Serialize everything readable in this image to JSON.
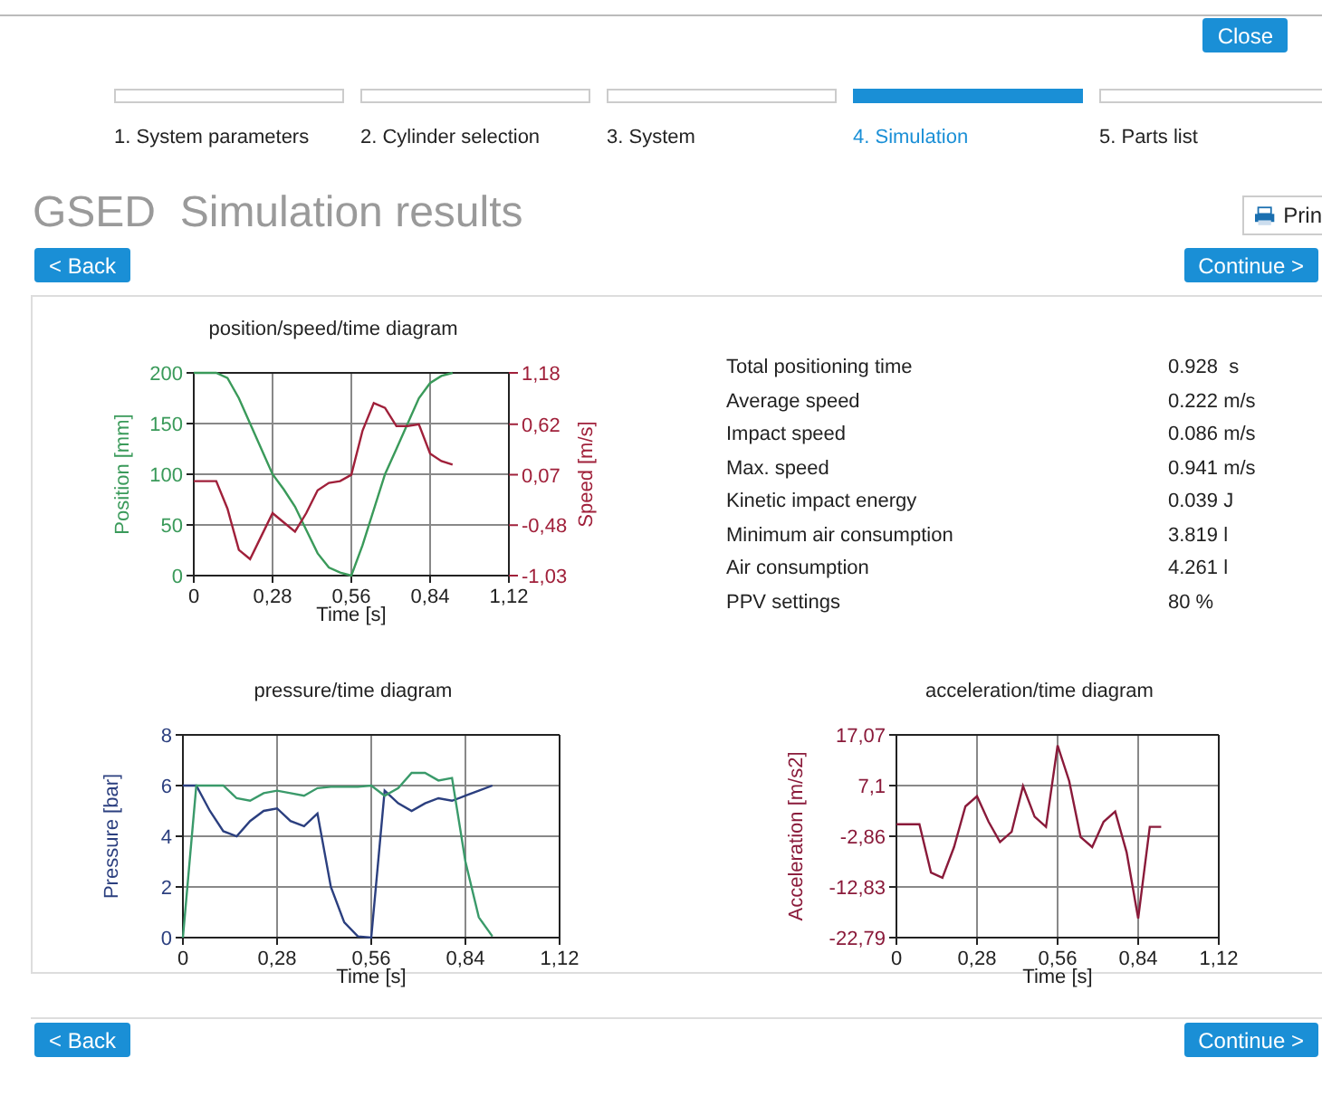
{
  "header": {
    "close_button": "Close"
  },
  "steps": [
    {
      "label": "1. System parameters",
      "selected": false
    },
    {
      "label": "2. Cylinder selection",
      "selected": false
    },
    {
      "label": "3. System",
      "selected": false
    },
    {
      "label": "4. Simulation",
      "selected": true
    },
    {
      "label": "5. Parts list",
      "selected": false
    }
  ],
  "page_title": "GSED  Simulation results",
  "print_button": "Prin",
  "top_nav": {
    "back": "< Back",
    "continue": "Continue >"
  },
  "charts": [
    {
      "chart_data": {
        "type": "line",
        "title": "position/speed/time diagram",
        "xlabel": "Time [s]",
        "ylabel": "Position [mm]",
        "y2label": "Speed [m/s]",
        "x": [
          0,
          0.04,
          0.08,
          0.12,
          0.16,
          0.2,
          0.24,
          0.28,
          0.32,
          0.36,
          0.4,
          0.44,
          0.48,
          0.52,
          0.56,
          0.6,
          0.64,
          0.68,
          0.72,
          0.76,
          0.8,
          0.84,
          0.88,
          0.92
        ],
        "series": [
          {
            "color": "#3a9a5a",
            "values": [
              200,
              200,
              200,
              195,
              175,
              150,
              125,
              100,
              85,
              68,
              45,
              22,
              8,
              3,
              0,
              30,
              65,
              100,
              125,
              150,
              175,
              190,
              197,
              200
            ]
          },
          {
            "color": "#a0203a",
            "axis": "y2",
            "values": [
              0,
              0,
              0,
              -0.3,
              -0.75,
              -0.85,
              -0.6,
              -0.35,
              -0.45,
              -0.55,
              -0.35,
              -0.1,
              -0.02,
              0,
              0.07,
              0.55,
              0.85,
              0.8,
              0.6,
              0.6,
              0.62,
              0.3,
              0.22,
              0.18
            ]
          }
        ],
        "xlim": [
          0,
          1.12
        ],
        "ylim": [
          0,
          200
        ],
        "grid": true,
        "y2lim": [
          -1.03,
          1.18
        ],
        "xticks": [
          {
            "value": 0,
            "label": "0"
          },
          {
            "value": 0.28,
            "label": "0,28"
          },
          {
            "value": 0.56,
            "label": "0,56"
          },
          {
            "value": 0.84,
            "label": "0,84"
          },
          {
            "value": 1.12,
            "label": "1,12"
          }
        ],
        "yticks": [
          0,
          50,
          100,
          150,
          200
        ],
        "y2ticks": [
          {
            "value": -1.03,
            "label": "-1,03"
          },
          {
            "value": -0.48,
            "label": "-0,48"
          },
          {
            "value": 0.07,
            "label": "0,07"
          },
          {
            "value": 0.62,
            "label": "0,62"
          },
          {
            "value": 1.18,
            "label": "1,18"
          }
        ]
      }
    },
    {
      "chart_data": {
        "type": "line",
        "title": "pressure/time diagram",
        "xlabel": "Time [s]",
        "ylabel": "Pressure [bar]",
        "x": [
          0,
          0.04,
          0.08,
          0.12,
          0.16,
          0.2,
          0.24,
          0.28,
          0.32,
          0.36,
          0.4,
          0.44,
          0.48,
          0.52,
          0.56,
          0.6,
          0.64,
          0.68,
          0.72,
          0.76,
          0.8,
          0.84,
          0.88,
          0.92
        ],
        "series": [
          {
            "color": "#2b3f7f",
            "values": [
              6,
              6,
              5,
              4.2,
              4,
              4.6,
              5,
              5.1,
              4.6,
              4.4,
              4.9,
              2,
              0.6,
              0.05,
              0,
              5.8,
              5.3,
              5,
              5.3,
              5.5,
              5.4,
              5.6,
              5.8,
              6
            ]
          },
          {
            "color": "#3a9a6a",
            "values": [
              0,
              6,
              6,
              6,
              5.5,
              5.4,
              5.7,
              5.8,
              5.7,
              5.6,
              5.9,
              5.95,
              5.95,
              5.95,
              6,
              5.6,
              5.9,
              6.5,
              6.5,
              6.2,
              6.3,
              3,
              0.8,
              0.05
            ]
          }
        ],
        "xlim": [
          0,
          1.12
        ],
        "ylim": [
          0,
          8
        ],
        "grid": true,
        "xticks": [
          {
            "value": 0,
            "label": "0"
          },
          {
            "value": 0.28,
            "label": "0,28"
          },
          {
            "value": 0.56,
            "label": "0,56"
          },
          {
            "value": 0.84,
            "label": "0,84"
          },
          {
            "value": 1.12,
            "label": "1,12"
          }
        ],
        "yticks": [
          0,
          2,
          4,
          6,
          8
        ]
      }
    },
    {
      "chart_data": {
        "type": "line",
        "title": "acceleration/time diagram",
        "xlabel": "Time [s]",
        "ylabel": "Acceleration [m/s2]",
        "x": [
          0,
          0.04,
          0.08,
          0.12,
          0.16,
          0.2,
          0.24,
          0.28,
          0.32,
          0.36,
          0.4,
          0.44,
          0.48,
          0.52,
          0.56,
          0.6,
          0.64,
          0.68,
          0.72,
          0.76,
          0.8,
          0.84,
          0.88,
          0.92
        ],
        "series": [
          {
            "color": "#8a1a3a",
            "values": [
              -0.5,
              -0.5,
              -0.5,
              -10,
              -11,
              -5,
              3,
              5,
              0,
              -4,
              -2,
              7,
              1,
              -1,
              15,
              8,
              -3,
              -5,
              0,
              2,
              -6,
              -19,
              -1,
              -1
            ]
          }
        ],
        "xlim": [
          0,
          1.12
        ],
        "ylim": [
          -22.79,
          17.07
        ],
        "grid": true,
        "xticks": [
          {
            "value": 0,
            "label": "0"
          },
          {
            "value": 0.28,
            "label": "0,28"
          },
          {
            "value": 0.56,
            "label": "0,56"
          },
          {
            "value": 0.84,
            "label": "0,84"
          },
          {
            "value": 1.12,
            "label": "1,12"
          }
        ],
        "yticks": [
          {
            "value": -22.79,
            "label": "-22,79"
          },
          {
            "value": -12.83,
            "label": "-12,83"
          },
          {
            "value": -2.86,
            "label": "-2,86"
          },
          {
            "value": 7.1,
            "label": "7,1"
          },
          {
            "value": 17.07,
            "label": "17,07"
          }
        ]
      }
    }
  ],
  "stats": [
    {
      "label": "Total positioning time",
      "value": "0.928  s"
    },
    {
      "label": "Average speed",
      "value": "0.222 m/s"
    },
    {
      "label": "Impact speed",
      "value": "0.086 m/s"
    },
    {
      "label": "Max. speed",
      "value": "0.941 m/s"
    },
    {
      "label": "Kinetic impact energy",
      "value": "0.039 J"
    },
    {
      "label": "Minimum air consumption",
      "value": "3.819 l"
    },
    {
      "label": "Air consumption",
      "value": "4.261 l"
    },
    {
      "label": "PPV settings",
      "value": "80 %"
    }
  ],
  "bottom_nav": {
    "back": "< Back",
    "continue": "Continue >"
  }
}
